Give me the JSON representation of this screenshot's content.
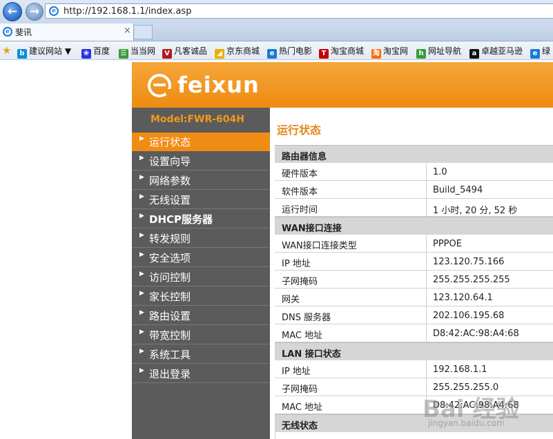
{
  "browser": {
    "url": "http://192.168.1.1/index.asp",
    "tab_title": "斐讯",
    "tab_close": "×",
    "favorites": [
      {
        "label": "建议网站 ▼",
        "icon": "bing-icon",
        "color": "#0a8fd6",
        "glyph": "b"
      },
      {
        "label": "百度",
        "icon": "baidu-paw-icon",
        "color": "#2932e1",
        "glyph": "❀"
      },
      {
        "label": "当当网",
        "icon": "dangdang-icon",
        "color": "#3a9a3a",
        "glyph": "☰"
      },
      {
        "label": "凡客诚品",
        "icon": "vancl-icon",
        "color": "#b31b1b",
        "glyph": "V"
      },
      {
        "label": "京东商城",
        "icon": "jd-icon",
        "color": "#e8b100",
        "glyph": "◢"
      },
      {
        "label": "热门电影",
        "icon": "ie-page-icon",
        "color": "#1a7ad6",
        "glyph": "e"
      },
      {
        "label": "淘宝商城",
        "icon": "tmall-icon",
        "color": "#c40000",
        "glyph": "T"
      },
      {
        "label": "淘宝网",
        "icon": "taobao-icon",
        "color": "#ff6a00",
        "glyph": "淘"
      },
      {
        "label": "网址导航",
        "icon": "hao123-icon",
        "color": "#3a9a3a",
        "glyph": "h"
      },
      {
        "label": "卓越亚马逊",
        "icon": "amazon-icon",
        "color": "#111111",
        "glyph": "a"
      },
      {
        "label": "绿",
        "icon": "ie-page-icon",
        "color": "#1a7ad6",
        "glyph": "e"
      }
    ]
  },
  "brand": {
    "logo_text": "feixun",
    "model": "Model:FWR-604H"
  },
  "sidebar": {
    "items": [
      {
        "label": "运行状态",
        "active": true
      },
      {
        "label": "设置向导"
      },
      {
        "label": "网络参数"
      },
      {
        "label": "无线设置"
      },
      {
        "label": "DHCP服务器"
      },
      {
        "label": "转发规则"
      },
      {
        "label": "安全选项"
      },
      {
        "label": "访问控制"
      },
      {
        "label": "家长控制"
      },
      {
        "label": "路由设置"
      },
      {
        "label": "带宽控制"
      },
      {
        "label": "系统工具"
      },
      {
        "label": "退出登录"
      }
    ],
    "arrow": "▶"
  },
  "main": {
    "title": "运行状态",
    "sections": [
      {
        "title": "路由器信息",
        "rows": [
          {
            "key": "硬件版本",
            "value": "1.0"
          },
          {
            "key": "软件版本",
            "value": "Build_5494"
          },
          {
            "key": "运行时间",
            "value": "1 小时, 20 分, 52 秒"
          }
        ]
      },
      {
        "title": "WAN接口连接",
        "rows": [
          {
            "key": "WAN接口连接类型",
            "value": "PPPOE"
          },
          {
            "key": "IP 地址",
            "value": "123.120.75.166"
          },
          {
            "key": "子网掩码",
            "value": "255.255.255.255"
          },
          {
            "key": "网关",
            "value": "123.120.64.1"
          },
          {
            "key": "DNS 服务器",
            "value": "202.106.195.68"
          },
          {
            "key": "MAC 地址",
            "value": "D8:42:AC:98:A4:68"
          }
        ]
      },
      {
        "title": "LAN 接口状态",
        "rows": [
          {
            "key": "IP 地址",
            "value": "192.168.1.1"
          },
          {
            "key": "子网掩码",
            "value": "255.255.255.0"
          },
          {
            "key": "MAC 地址",
            "value": "D8:42:AC:98:A4:68"
          }
        ]
      },
      {
        "title": "无线状态",
        "rows": []
      }
    ]
  },
  "watermark": {
    "text": "Bai 经验",
    "sub": "jingyan.baidu.com"
  },
  "colors": {
    "accent": "#f08c14",
    "sidebar": "#5b5b5b",
    "section": "#d6d6d6"
  }
}
